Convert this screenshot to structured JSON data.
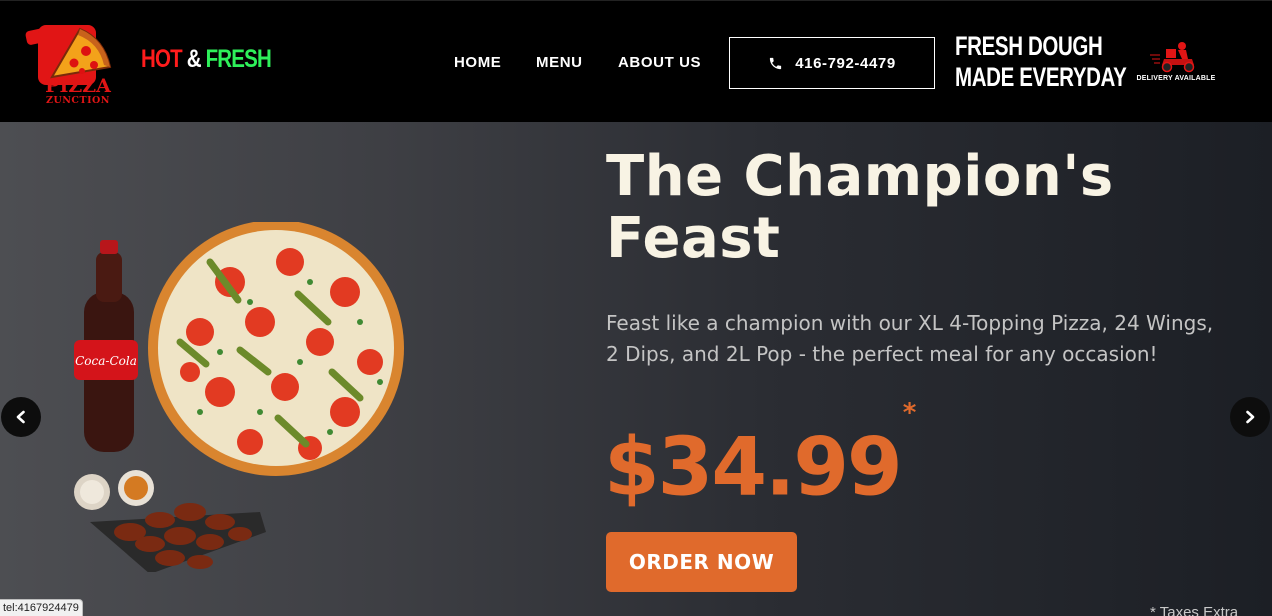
{
  "header": {
    "logo": {
      "line1": "PIZZA",
      "line2": "ZUNCTION",
      "icon": "pizza-paddle-logo"
    },
    "tagline": {
      "hot": "HOT",
      "amp": "&",
      "fresh": "FRESH",
      "colors": {
        "hot": "#ff1c1c",
        "fresh": "#2ef05a"
      }
    },
    "nav": [
      {
        "label": "HOME"
      },
      {
        "label": "MENU"
      },
      {
        "label": "ABOUT US"
      }
    ],
    "phone": {
      "label": "416-792-4479",
      "icon": "phone-icon"
    },
    "fresh_dough": {
      "line1": "FRESH DOUGH",
      "line2": "MADE EVERYDAY"
    },
    "delivery": {
      "label": "DELIVERY AVAILABLE",
      "icon": "delivery-scooter-icon"
    }
  },
  "hero": {
    "title": "The Champion's Feast",
    "description": "Feast like a champion with our XL 4-Topping Pizza, 24 Wings, 2 Dips, and 2L Pop - the perfect meal for any occasion!",
    "price": "$34.99",
    "price_mark": "*",
    "order_button": "ORDER NOW",
    "taxes_note": "* Taxes Extra",
    "prev_icon": "chevron-left-icon",
    "next_icon": "chevron-right-icon",
    "accent_color": "#e06a2c"
  },
  "status_bar": {
    "url": "tel:4167924479"
  }
}
